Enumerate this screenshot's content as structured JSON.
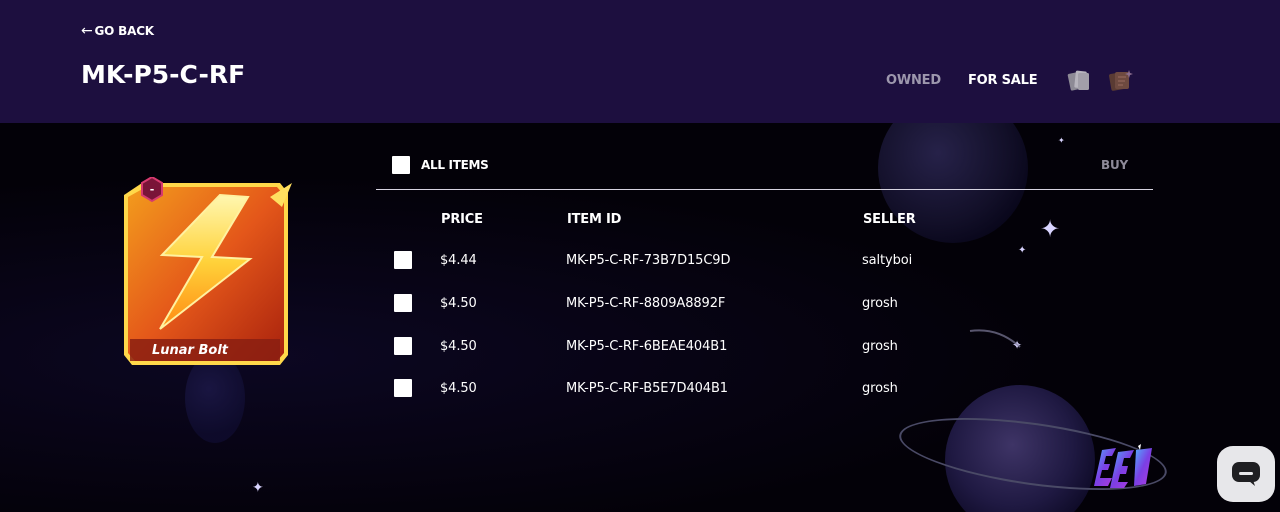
{
  "header": {
    "back_arrow": "←",
    "back_label": "GO BACK",
    "title": "MK-P5-C-RF",
    "tabs": {
      "owned": "OWNED",
      "for_sale": "FOR SALE"
    },
    "view_icons": [
      "cards-stack-icon",
      "card-brown-icon"
    ]
  },
  "card": {
    "name": "Lunar Bolt",
    "badge_symbol": "-",
    "art": "lightning-bolt-icon"
  },
  "listing": {
    "all_items_label": "ALL ITEMS",
    "buy_label": "BUY",
    "columns": {
      "price": "PRICE",
      "item_id": "ITEM ID",
      "seller": "SELLER"
    },
    "rows": [
      {
        "price": "$4.44",
        "item_id": "MK-P5-C-RF-73B7D15C9D",
        "seller": "saltyboi"
      },
      {
        "price": "$4.50",
        "item_id": "MK-P5-C-RF-8809A8892F",
        "seller": "grosh"
      },
      {
        "price": "$4.50",
        "item_id": "MK-P5-C-RF-6BEAE404B1",
        "seller": "grosh"
      },
      {
        "price": "$4.50",
        "item_id": "MK-P5-C-RF-B5E7D404B1",
        "seller": "grosh"
      }
    ]
  },
  "colors": {
    "header_bg": "#1d0f3f",
    "page_bg": "#030108",
    "accent_purple": "#7b3fe4",
    "muted": "#9d97ad"
  },
  "icons": {
    "chat": "chat-bubble-icon",
    "logo": "brand-logo-icon"
  }
}
